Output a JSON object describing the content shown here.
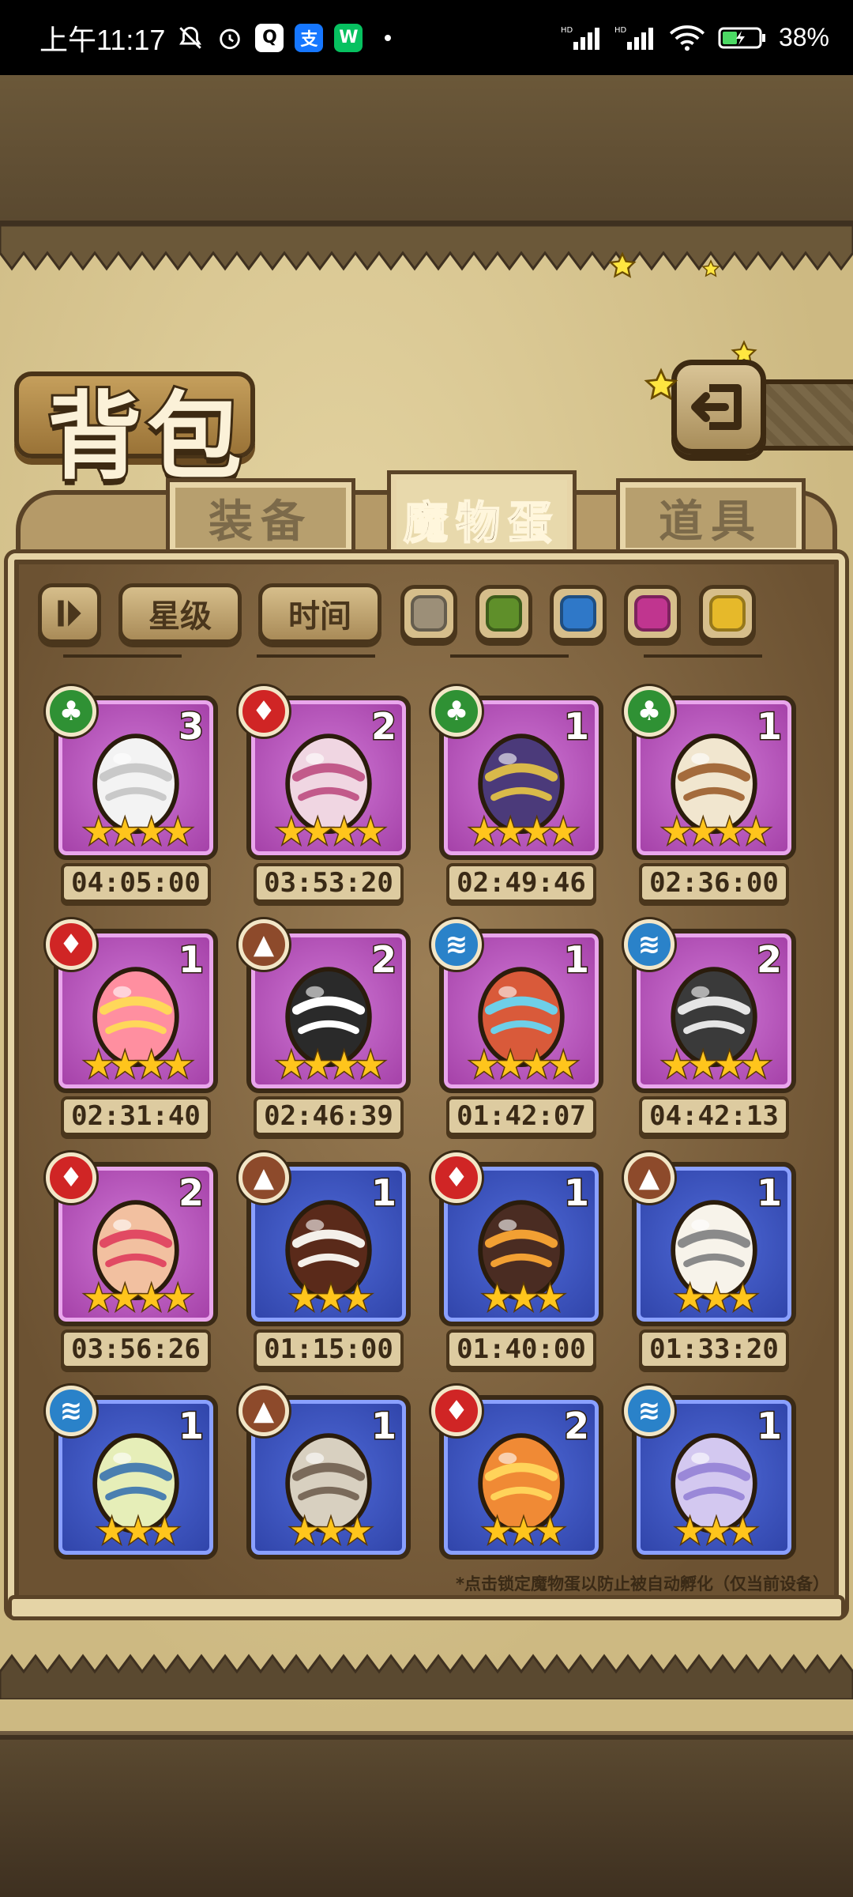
{
  "status_bar": {
    "time": "上午11:17",
    "battery": "38%",
    "icons": [
      "bell-off-icon",
      "alarm-icon",
      "qq-icon",
      "alipay-icon",
      "wechat-icon",
      "dot-icon",
      "hd-signal-icon",
      "hd-signal-icon",
      "wifi-icon",
      "battery-charging-icon"
    ]
  },
  "header": {
    "title": "背包",
    "back_icon": "back-arrow-icon"
  },
  "tabs": [
    {
      "label": "装备",
      "active": false
    },
    {
      "label": "魔物蛋",
      "active": true
    },
    {
      "label": "道具",
      "active": false
    }
  ],
  "filters": {
    "sort_toggle_icon": "sort-toggle-icon",
    "star_label": "星级",
    "time_label": "时间",
    "colors": [
      "#9c8f78",
      "#5f8f2a",
      "#2f78c8",
      "#c0358f",
      "#e6b92a"
    ]
  },
  "eggs": [
    {
      "element": "nature",
      "rarity": "purple",
      "stars": 4,
      "count": "3",
      "timer": "04:05:00",
      "art": "tank-egg"
    },
    {
      "element": "fire",
      "rarity": "purple",
      "stars": 4,
      "count": "2",
      "timer": "03:53:20",
      "art": "bat-egg"
    },
    {
      "element": "nature",
      "rarity": "purple",
      "stars": 4,
      "count": "1",
      "timer": "02:49:46",
      "art": "butterfly-egg"
    },
    {
      "element": "nature",
      "rarity": "purple",
      "stars": 4,
      "count": "1",
      "timer": "02:36:00",
      "art": "feather-egg"
    },
    {
      "element": "fire",
      "rarity": "purple",
      "stars": 4,
      "count": "1",
      "timer": "02:31:40",
      "art": "crown-egg"
    },
    {
      "element": "earth",
      "rarity": "purple",
      "stars": 4,
      "count": "2",
      "timer": "02:46:39",
      "art": "spider-egg"
    },
    {
      "element": "water",
      "rarity": "purple",
      "stars": 4,
      "count": "1",
      "timer": "01:42:07",
      "art": "feather-head-egg"
    },
    {
      "element": "water",
      "rarity": "purple",
      "stars": 4,
      "count": "2",
      "timer": "04:42:13",
      "art": "spike-egg"
    },
    {
      "element": "fire",
      "rarity": "purple",
      "stars": 4,
      "count": "2",
      "timer": "03:56:26",
      "art": "kimono-egg"
    },
    {
      "element": "earth",
      "rarity": "blue",
      "stars": 3,
      "count": "1",
      "timer": "01:15:00",
      "art": "chocolate-egg"
    },
    {
      "element": "fire",
      "rarity": "blue",
      "stars": 3,
      "count": "1",
      "timer": "01:40:00",
      "art": "fire-claw-egg"
    },
    {
      "element": "earth",
      "rarity": "blue",
      "stars": 3,
      "count": "1",
      "timer": "01:33:20",
      "art": "wool-egg"
    },
    {
      "element": "water",
      "rarity": "blue",
      "stars": 3,
      "count": "1",
      "timer": "",
      "art": "bow-egg"
    },
    {
      "element": "earth",
      "rarity": "blue",
      "stars": 3,
      "count": "1",
      "timer": "",
      "art": "cleaver-egg"
    },
    {
      "element": "fire",
      "rarity": "blue",
      "stars": 3,
      "count": "2",
      "timer": "",
      "art": "flame-egg"
    },
    {
      "element": "water",
      "rarity": "blue",
      "stars": 3,
      "count": "1",
      "timer": "",
      "art": "jelly-egg"
    }
  ],
  "hint": "*点击锁定魔物蛋以防止被自动孵化（仅当前设备）"
}
